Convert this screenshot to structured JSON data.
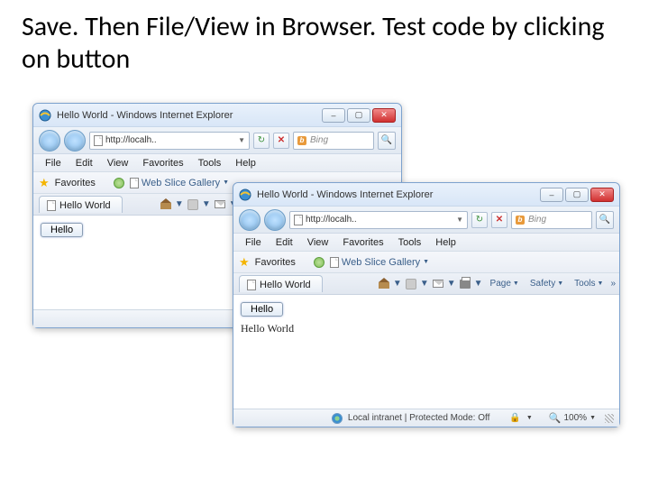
{
  "slide": {
    "title": "Save.  Then File/View in Browser. Test code by clicking on button"
  },
  "ie": {
    "title": "Hello World - Windows Internet Explorer",
    "address": "http://localh..",
    "search_placeholder": "Bing",
    "menu": {
      "file": "File",
      "edit": "Edit",
      "view": "View",
      "favorites": "Favorites",
      "tools": "Tools",
      "help": "Help"
    },
    "favbar": {
      "label": "Favorites",
      "webslice": "Web Slice Gallery"
    },
    "tab": "Hello World",
    "toolbar": {
      "page": "Page",
      "safety": "Safety",
      "tools": "Tools",
      "more": "»"
    },
    "status_zone": "Local intranet | Protected Mode: Off",
    "status_zone_cut": "Local intranet | Protect",
    "zoom": "100%"
  },
  "page": {
    "button_label": "Hello",
    "output": "Hello World"
  }
}
